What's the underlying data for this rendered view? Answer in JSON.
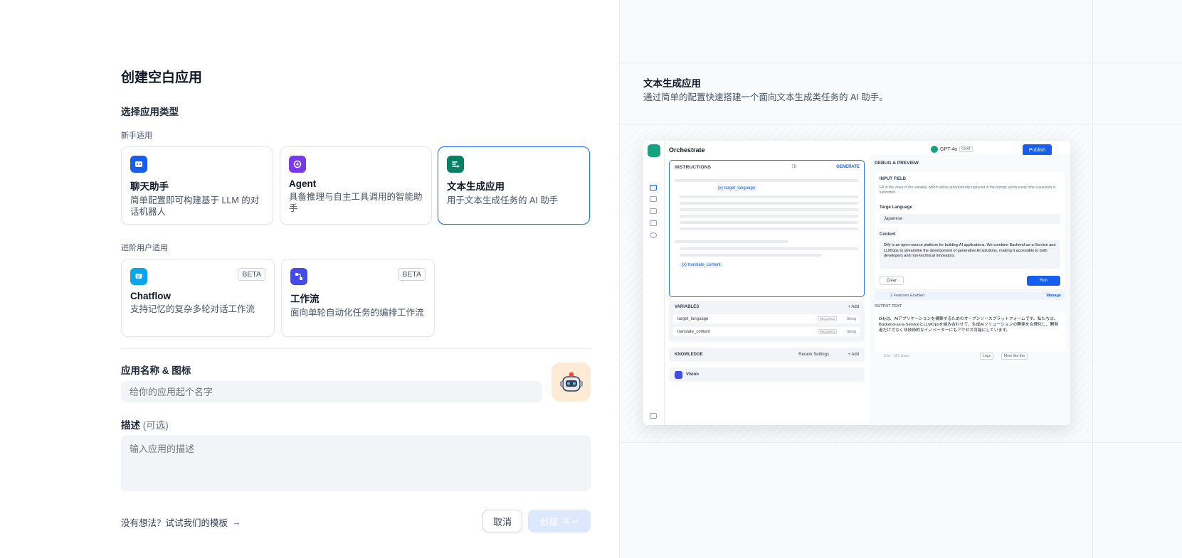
{
  "page": {
    "title": "创建空白应用",
    "choose_type": "选择应用类型",
    "group_beginner": "新手适用",
    "group_advanced": "进阶用户适用"
  },
  "cards": [
    {
      "name": "聊天助手",
      "desc": "简单配置即可构建基于 LLM 的对话机器人",
      "icon": "chat-bot-icon",
      "color": "#155eef"
    },
    {
      "name": "Agent",
      "desc": "具备推理与自主工具调用的智能助手",
      "icon": "agent-icon",
      "color": "#7839ee"
    },
    {
      "name": "文本生成应用",
      "desc": "用于文本生成任务的 AI 助手",
      "icon": "text-generation-icon",
      "color": "#088066",
      "selected": true
    },
    {
      "name": "Chatflow",
      "desc": "支持记忆的复杂多轮对话工作流",
      "icon": "chatflow-icon",
      "color": "#0ba5ec",
      "badge": "BETA"
    },
    {
      "name": "工作流",
      "desc": "面向单轮自动化任务的编排工作流",
      "icon": "workflow-icon",
      "color": "#444ce7",
      "badge": "BETA"
    }
  ],
  "form": {
    "name_label": "应用名称 & 图标",
    "name_placeholder": "给你的应用起个名字",
    "desc_label": "描述",
    "desc_optional": "(可选)",
    "desc_placeholder": "输入应用的描述"
  },
  "footer": {
    "template_link": "没有想法？试试我们的模板",
    "template_arrow": "→",
    "cancel": "取消",
    "create": "创建",
    "create_shortcut": "⌘ ↵"
  },
  "preview": {
    "title": "文本生成应用",
    "subtitle": "通过简单的配置快速搭建一个面向文本生成类任务的 AI 助手。",
    "header": "Orchestrate",
    "model": "GPT-4o",
    "model_chip": "CHAT",
    "publish": "Publish",
    "instructions": "INSTRUCTIONS",
    "instr_count": "78",
    "generate": "GENERATE",
    "var_target": "{x} target_language",
    "var_translate": "{x} translate_content",
    "variables": "VARIABLES",
    "add": "+ Add",
    "rows": [
      {
        "name": "target_language",
        "req": "REQUIRED",
        "type": "String"
      },
      {
        "name": "translate_content",
        "req": "REQUIRED",
        "type": "String"
      }
    ],
    "knowledge": "KNOWLEDGE",
    "rerank": "Rerank Settings",
    "vision": "Vision",
    "debug": "DEBUG & PREVIEW",
    "input_field": "INPUT FIELD",
    "input_hint": "Fill in the value of the variable, which will be automatically replaced in the prompt words every time a question is submitted.",
    "target_label": "Targe Language",
    "target_value": "Japanese",
    "content_label": "Content",
    "content_value": "Dify is an open-source platform for building AI applications. We combine Backend-as-a-Service and LLMOps to streamline the development of generative AI solutions, making it accessible to both developers and non-technical innovators.",
    "clear": "Clear",
    "run": "Run",
    "features": "2 Features Enabled",
    "manage": "Manage",
    "output_text": "OUTPUT TEXT",
    "output": "Difyは、AIアプリケーションを構築するためのオープンソースプラットフォームです。私たちは、Backend-as-a-ServiceとLLMOpsを組み合わせて、生成AIソリューションの開発を合理化し、開発者だけでなく非技術的なイノベーターにもアクセス可能にしています。",
    "stats": "5.6s · 321 chars",
    "logs": "Logs",
    "more": "More like this"
  }
}
